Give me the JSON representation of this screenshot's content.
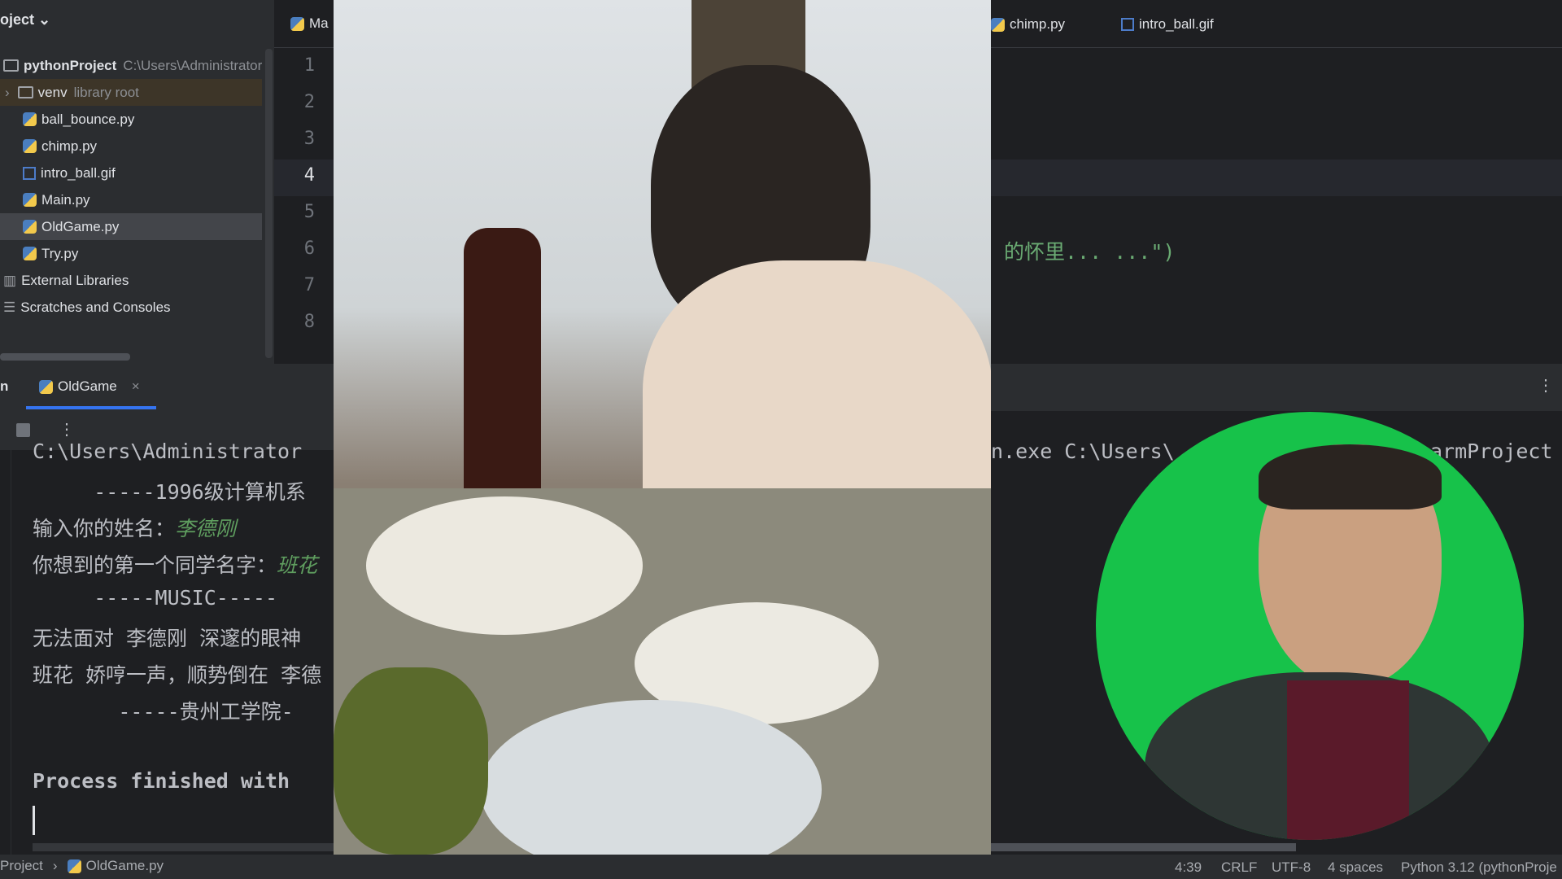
{
  "sidebar": {
    "title": "oject",
    "root": {
      "name": "pythonProject",
      "path": "C:\\Users\\Administrator"
    },
    "items": [
      {
        "name": "venv",
        "note": "library root",
        "type": "folder"
      },
      {
        "name": "ball_bounce.py",
        "type": "py"
      },
      {
        "name": "chimp.py",
        "type": "py"
      },
      {
        "name": "intro_ball.gif",
        "type": "gif"
      },
      {
        "name": "Main.py",
        "type": "py"
      },
      {
        "name": "OldGame.py",
        "type": "py",
        "selected": true
      },
      {
        "name": "Try.py",
        "type": "py"
      }
    ],
    "external": "External Libraries",
    "scratches": "Scratches and Consoles"
  },
  "editor": {
    "left_tab": "Ma",
    "right_tabs": [
      "chimp.py",
      "intro_ball.gif"
    ],
    "line_numbers": [
      "1",
      "2",
      "3",
      "4",
      "5",
      "6",
      "7",
      "8"
    ],
    "current_line": "4",
    "code_line6": "的怀里... ...\")"
  },
  "run": {
    "prefix": "n",
    "tab": "OldGame",
    "close": "×",
    "right_text": "n.exe C:\\Users\\",
    "right_text2": "armProject",
    "lines": [
      "C:\\Users\\Administrator",
      "     -----1996级计算机系",
      "输入你的姓名：",
      "你想到的第一个同学名字：",
      "     -----MUSIC-----",
      "无法面对 李德刚 深邃的眼神",
      "班花 娇哼一声，顺势倒在 李德",
      "       -----贵州工学院-",
      "",
      "Process finished with"
    ],
    "input_name": "李德刚",
    "input_classmate": "班花"
  },
  "breadcrumb": [
    "Project",
    "OldGame.py"
  ],
  "status": {
    "position": "4:39",
    "line_sep": "CRLF",
    "encoding": "UTF-8",
    "indent": "4 spaces",
    "interpreter": "Python 3.12 (pythonProje"
  },
  "colors": {
    "accent": "#3574f0",
    "string": "#6aab73",
    "webcam_bg": "#17c24a"
  }
}
